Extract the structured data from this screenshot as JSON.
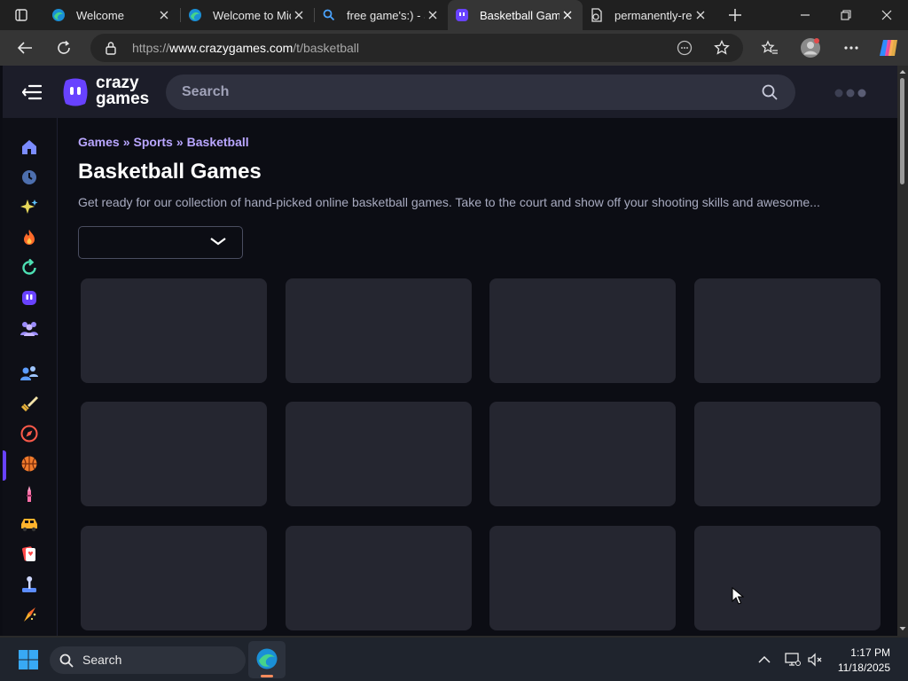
{
  "browser": {
    "tabs": [
      {
        "title": "Welcome",
        "favicon": "edge-icon",
        "active": false
      },
      {
        "title": "Welcome to Mic",
        "favicon": "edge-icon",
        "active": false
      },
      {
        "title": "free game's:) - Se",
        "favicon": "search-icon",
        "active": false
      },
      {
        "title": "Basketball Game",
        "favicon": "crazygames-icon",
        "active": true
      },
      {
        "title": "permanently-ren",
        "favicon": "document-icon",
        "active": false
      }
    ],
    "url_prefix": "https://",
    "url_domain": "www.crazygames.com",
    "url_path": "/t/basketball"
  },
  "site": {
    "logo_top": "crazy",
    "logo_bottom": "games",
    "search_placeholder": "Search",
    "sidebar_icons": [
      "home-icon",
      "recent-icon",
      "new-icon",
      "trending-icon",
      "updated-icon",
      "originals-icon",
      "multiplayer-icon",
      "two-player-icon",
      "action-icon",
      "adventure-icon",
      "basketball-icon",
      "beauty-icon",
      "car-icon",
      "card-icon",
      "casual-icon",
      "clicker-icon"
    ]
  },
  "main": {
    "breadcrumb": [
      "Games",
      "Sports",
      "Basketball"
    ],
    "breadcrumb_sep": "»",
    "title": "Basketball Games",
    "description": "Get ready for our collection of hand-picked online basketball games. Take to the court and show off your shooting skills and awesome...",
    "sort_value": ""
  },
  "taskbar": {
    "search_label": "Search",
    "time": "1:17 PM",
    "date": "11/18/2025"
  },
  "colors": {
    "accent": "#6842ff",
    "breadcrumb": "#b9a6ff",
    "header_bg": "#1c1d29",
    "tile_placeholder": "#252630"
  }
}
